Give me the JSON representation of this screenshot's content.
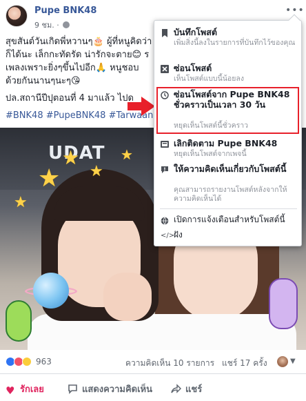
{
  "post": {
    "page_name": "Pupe BNK48",
    "time": "9 ชม.",
    "body_lines": [
      "สุขสันต์วันเกิดพี่หวานๆ🎂 ผู้ที่หนูคิดว่า",
      "ก็ได้นะ เล็กกะทัดรัด น่ารักจะตาย😊 ร",
      "เพลงเพราะยิ่งๆขึ้นไปอีก🙏 หนูชอบ",
      "ด้วยกันนานๆนะๆ😘"
    ],
    "ref_line": "ปล.สถานีปีปุตอนที่ 4 มาแล้ว ไปด",
    "hashtags": "#BNK48 #PupeBNK48 #Tarwaan",
    "photo_sign": "UDAT"
  },
  "reactions": {
    "count": "963",
    "comments": "ความคิดเห็น 10 รายการ",
    "shares": "แชร์ 17 ครั้ง"
  },
  "actions": {
    "love": "รักเลย",
    "comment": "แสดงความคิดเห็น",
    "share": "แชร์"
  },
  "menu": {
    "save": {
      "title": "บันทึกโพสต์",
      "sub": "เพิ่มสิ่งนี้ลงในรายการที่บันทึกไว้ของคุณ"
    },
    "hide": {
      "title": "ซ่อนโพสต์",
      "sub": "เห็นโพสต์แบบนี้น้อยลง"
    },
    "snooze": {
      "title": "ซ่อนโพสต์จาก Pupe BNK48 ชั่วคราวเป็นเวลา 30 วัน",
      "sub": "หยุดเห็นโพสต์นี้ชั่วคราว"
    },
    "unfollow": {
      "title": "เลิกติดตาม Pupe BNK48",
      "sub": "หยุดเห็นโพสต์จากเพจนี้"
    },
    "feedback": {
      "title": "ให้ความคิดเห็นเกี่ยวกับโพสต์นี้",
      "sub": "คุณสามารถรายงานโพสต์หลังจากให้ความคิดเห็นได้"
    },
    "notifications": {
      "title": "เปิดการแจ้งเตือนสำหรับโพสต์นี้"
    },
    "embed": {
      "title": "ฝัง"
    }
  },
  "colors": {
    "link": "#385898",
    "highlight": "#e8202a",
    "love": "#e0245e"
  }
}
